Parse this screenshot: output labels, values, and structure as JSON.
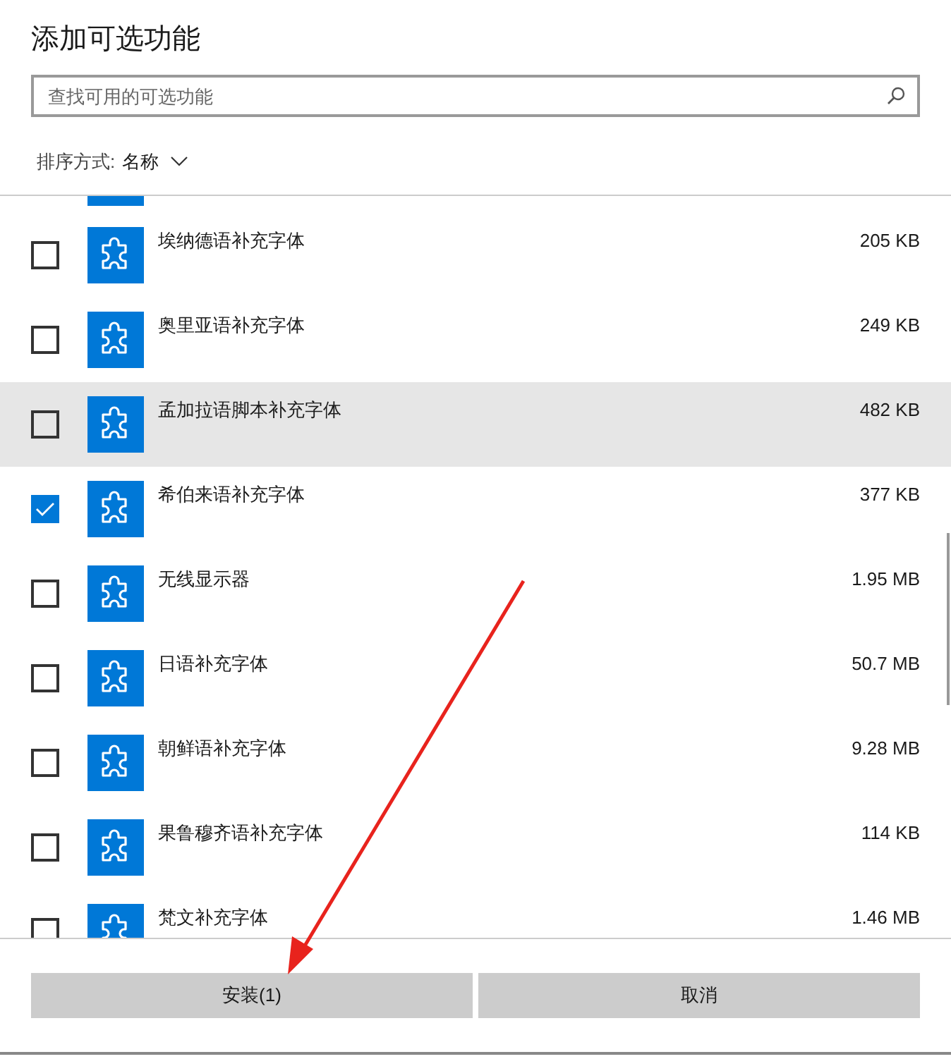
{
  "title": "添加可选功能",
  "search": {
    "placeholder": "查找可用的可选功能"
  },
  "sort": {
    "label": "排序方式:",
    "value": "名称"
  },
  "features": [
    {
      "name": "埃纳德语补充字体",
      "size": "205 KB",
      "checked": false,
      "selected": false
    },
    {
      "name": "奥里亚语补充字体",
      "size": "249 KB",
      "checked": false,
      "selected": false
    },
    {
      "name": "孟加拉语脚本补充字体",
      "size": "482 KB",
      "checked": false,
      "selected": true
    },
    {
      "name": "希伯来语补充字体",
      "size": "377 KB",
      "checked": true,
      "selected": false
    },
    {
      "name": "无线显示器",
      "size": "1.95 MB",
      "checked": false,
      "selected": false
    },
    {
      "name": "日语补充字体",
      "size": "50.7 MB",
      "checked": false,
      "selected": false
    },
    {
      "name": "朝鲜语补充字体",
      "size": "9.28 MB",
      "checked": false,
      "selected": false
    },
    {
      "name": "果鲁穆齐语补充字体",
      "size": "114 KB",
      "checked": false,
      "selected": false
    },
    {
      "name": "梵文补充字体",
      "size": "1.46 MB",
      "checked": false,
      "selected": false
    }
  ],
  "buttons": [
    "安装(1)",
    "取消"
  ]
}
